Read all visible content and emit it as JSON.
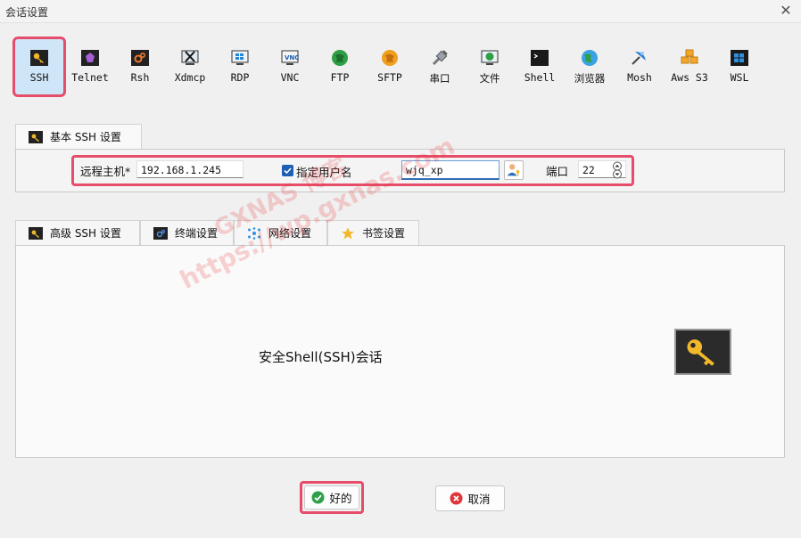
{
  "window": {
    "title": "会话设置"
  },
  "session_types": [
    {
      "label": "SSH",
      "icon": "key-icon"
    },
    {
      "label": "Telnet",
      "icon": "telnet-icon"
    },
    {
      "label": "Rsh",
      "icon": "rsh-icon"
    },
    {
      "label": "Xdmcp",
      "icon": "xdmcp-icon"
    },
    {
      "label": "RDP",
      "icon": "rdp-icon"
    },
    {
      "label": "VNC",
      "icon": "vnc-icon"
    },
    {
      "label": "FTP",
      "icon": "ftp-icon"
    },
    {
      "label": "SFTP",
      "icon": "sftp-icon"
    },
    {
      "label": "串口",
      "icon": "serial-icon"
    },
    {
      "label": "文件",
      "icon": "file-icon"
    },
    {
      "label": "Shell",
      "icon": "shell-icon"
    },
    {
      "label": "浏览器",
      "icon": "browser-icon"
    },
    {
      "label": "Mosh",
      "icon": "mosh-icon"
    },
    {
      "label": "Aws S3",
      "icon": "aws-s3-icon"
    },
    {
      "label": "WSL",
      "icon": "wsl-icon"
    }
  ],
  "basic": {
    "tab_label": "基本 SSH 设置",
    "remote_host_label": "远程主机*",
    "remote_host_value": "192.168.1.245",
    "specify_user_label": "指定用户名",
    "specify_user_checked": true,
    "username_value": "wjq_xp",
    "port_label": "端口",
    "port_value": "22"
  },
  "advanced_tabs": [
    {
      "label": "高级 SSH 设置"
    },
    {
      "label": "终端设置"
    },
    {
      "label": "网络设置"
    },
    {
      "label": "书签设置"
    }
  ],
  "description": "安全Shell(SSH)会话",
  "watermark": {
    "line1": "GXNAS 博客",
    "line2": "https://wp.gxnas.com"
  },
  "buttons": {
    "ok": "好的",
    "cancel": "取消"
  },
  "colors": {
    "highlight": "#e64d6a",
    "selected_bg": "#cfe5f8",
    "accent": "#1d5fb4"
  }
}
